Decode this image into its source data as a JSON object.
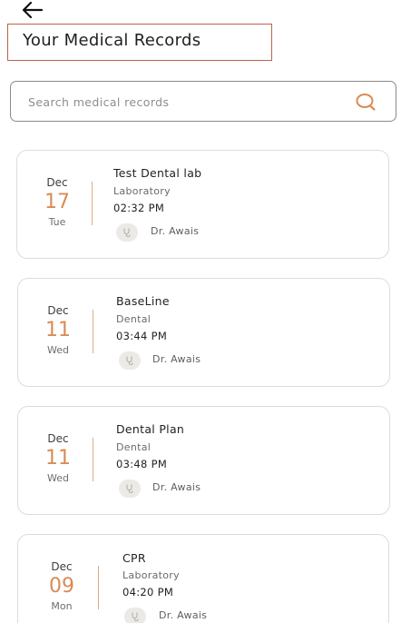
{
  "header": {
    "back_icon": "arrow-left-icon",
    "title": "Your Medical Records"
  },
  "search": {
    "placeholder": "Search medical records",
    "value": "",
    "icon": "search-icon",
    "icon_color": "#d88c56"
  },
  "colors": {
    "accent": "#d88c56",
    "title_border": "#c0604a",
    "card_border": "#e1dbd4"
  },
  "records": [
    {
      "month": "Dec",
      "day": "17",
      "weekday": "Tue",
      "title": "Test Dental lab",
      "category": "Laboratory",
      "time": "02:32 PM",
      "doctor": "Dr. Awais"
    },
    {
      "month": "Dec",
      "day": "11",
      "weekday": "Wed",
      "title": "BaseLine",
      "category": "Dental",
      "time": "03:44 PM",
      "doctor": "Dr. Awais"
    },
    {
      "month": "Dec",
      "day": "11",
      "weekday": "Wed",
      "title": "Dental Plan",
      "category": "Dental",
      "time": "03:48 PM",
      "doctor": "Dr. Awais"
    },
    {
      "month": "Dec",
      "day": "09",
      "weekday": "Mon",
      "title": "CPR",
      "category": "Laboratory",
      "time": "04:20 PM",
      "doctor": "Dr. Awais"
    }
  ]
}
